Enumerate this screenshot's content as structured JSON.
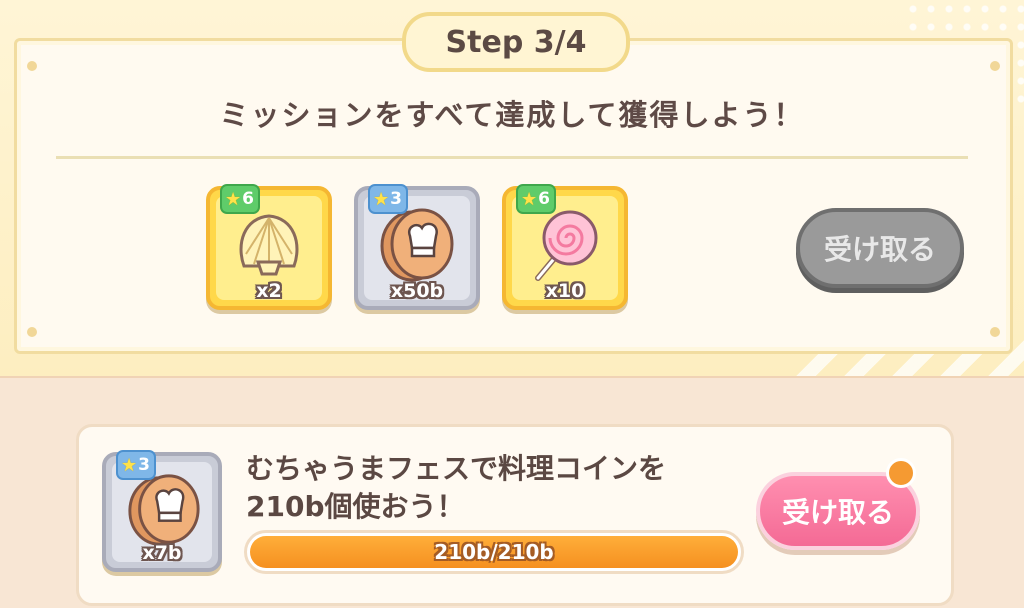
{
  "step": {
    "label": "Step 3/4"
  },
  "mission_header": {
    "text": "ミッションをすべて達成して獲得しよう！"
  },
  "rewards": [
    {
      "icon": "scallop-shell-icon",
      "rarity": "gold",
      "stars": "6",
      "quantity": "x2"
    },
    {
      "icon": "cooking-coin-icon",
      "rarity": "silver",
      "stars": "3",
      "quantity": "x50b"
    },
    {
      "icon": "lollipop-icon",
      "rarity": "gold",
      "stars": "6",
      "quantity": "x10"
    }
  ],
  "claim_step": {
    "label": "受け取る",
    "state": "disabled"
  },
  "mission": {
    "reward": {
      "icon": "cooking-coin-icon",
      "rarity": "silver",
      "stars": "3",
      "quantity": "x7b"
    },
    "text": "むちゃうまフェスで料理コインを210b個使おう！",
    "progress": {
      "text": "210b/210b",
      "fraction": 1.0
    },
    "claim": {
      "label": "受け取る",
      "state": "enabled",
      "has_notification": true
    }
  },
  "colors": {
    "gold": "#ffd84a",
    "silver": "#c9ccd7",
    "progress": "#f59020",
    "claim_pink": "#f46a95",
    "disabled_gray": "#9a9a9a"
  }
}
